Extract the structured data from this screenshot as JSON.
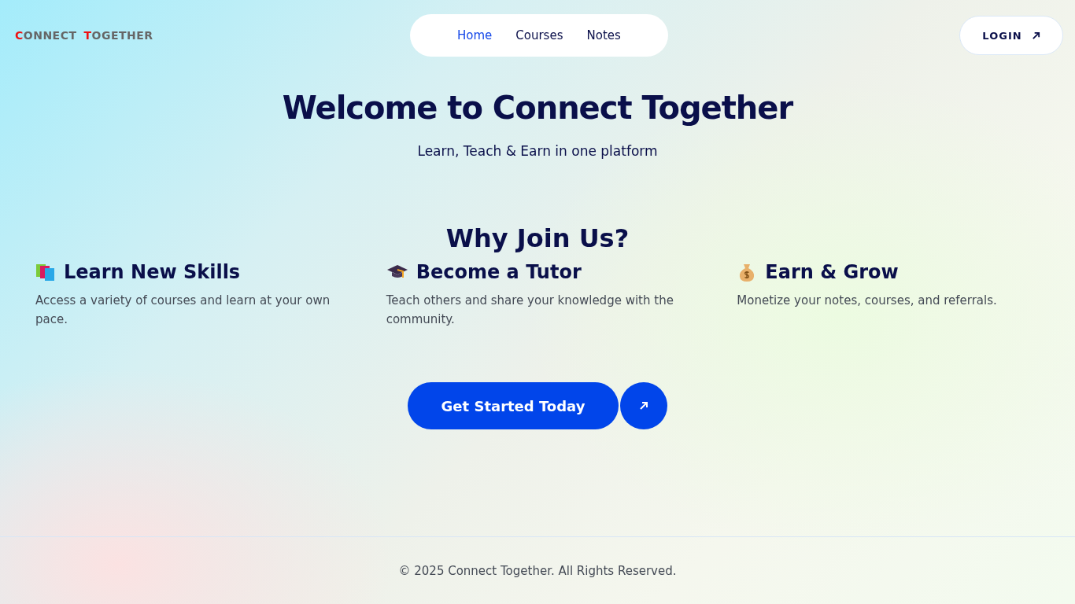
{
  "logo": {
    "words": [
      "CONNECT",
      "TOGETHER"
    ]
  },
  "nav": [
    {
      "label": "Home",
      "selected": true
    },
    {
      "label": "Courses",
      "selected": false
    },
    {
      "label": "Notes",
      "selected": false
    }
  ],
  "login": {
    "label": "LOGIN"
  },
  "hero": {
    "title": "Welcome to Connect Together",
    "subtitle": "Learn, Teach & Earn in one platform"
  },
  "features": {
    "title": "Why Join Us?",
    "items": [
      {
        "kind": "books",
        "title": "Learn New Skills",
        "text": "Access a variety of courses and learn at your own pace."
      },
      {
        "kind": "cap",
        "title": "Become a Tutor",
        "text": "Teach others and share your knowledge with the community."
      },
      {
        "kind": "money",
        "title": "Earn & Grow",
        "text": "Monetize your notes, courses, and referrals."
      }
    ]
  },
  "cta": {
    "label": "Get Started Today"
  },
  "footer": {
    "text": "© 2025 Connect Together. All Rights Reserved."
  }
}
